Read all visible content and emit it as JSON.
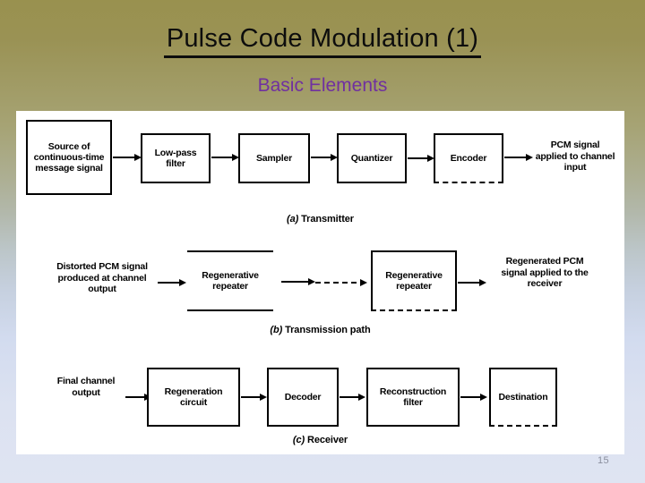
{
  "slide": {
    "title": "Pulse Code Modulation (1)",
    "subtitle": "Basic Elements",
    "page_number": "15",
    "colors": {
      "background_top": "#99914f",
      "background_bottom": "#dfe4f2",
      "title": "#0d0d0d",
      "subtitle": "#7030a0",
      "panel": "#ffffff",
      "diagram_line": "#000000",
      "page_number": "#8a8f9e"
    }
  },
  "diagram": {
    "rows": [
      {
        "id": "transmitter",
        "caption_prefix": "(a)",
        "caption_text": "Transmitter",
        "nodes": [
          {
            "type": "box",
            "label": "Source of continuous-time message signal"
          },
          {
            "type": "box",
            "label": "Low-pass filter"
          },
          {
            "type": "box",
            "label": "Sampler"
          },
          {
            "type": "box",
            "label": "Quantizer"
          },
          {
            "type": "box",
            "label": "Encoder"
          },
          {
            "type": "label",
            "label": "PCM signal applied to channel input"
          }
        ]
      },
      {
        "id": "transmission-path",
        "caption_prefix": "(b)",
        "caption_text": "Transmission path",
        "nodes": [
          {
            "type": "label",
            "label": "Distorted PCM signal produced at channel output"
          },
          {
            "type": "box",
            "label": "Regenerative repeater"
          },
          {
            "type": "box",
            "label": "Regenerative repeater"
          },
          {
            "type": "label",
            "label": "Regenerated PCM signal applied to the receiver"
          }
        ]
      },
      {
        "id": "receiver",
        "caption_prefix": "(c)",
        "caption_text": "Receiver",
        "nodes": [
          {
            "type": "label",
            "label": "Final channel output"
          },
          {
            "type": "box",
            "label": "Regeneration circuit"
          },
          {
            "type": "box",
            "label": "Decoder"
          },
          {
            "type": "box",
            "label": "Reconstruction filter"
          },
          {
            "type": "box",
            "label": "Destination"
          }
        ]
      }
    ],
    "labels": {
      "a_source": "Source of continuous-time message signal",
      "a_lowpass": "Low-pass filter",
      "a_sampler": "Sampler",
      "a_quantizer": "Quantizer",
      "a_encoder": "Encoder",
      "a_output": "PCM signal applied to channel input",
      "a_caption_prefix": "(a)",
      "a_caption": "Transmitter",
      "b_input": "Distorted PCM signal produced at channel output",
      "b_repeater1": "Regenerative repeater",
      "b_repeater2": "Regenerative repeater",
      "b_output": "Regenerated PCM signal applied to the receiver",
      "b_caption_prefix": "(b)",
      "b_caption": "Transmission path",
      "c_input": "Final channel output",
      "c_regen": "Regeneration circuit",
      "c_decoder": "Decoder",
      "c_reconstruction": "Reconstruction filter",
      "c_destination": "Destination",
      "c_caption_prefix": "(c)",
      "c_caption": "Receiver"
    }
  }
}
